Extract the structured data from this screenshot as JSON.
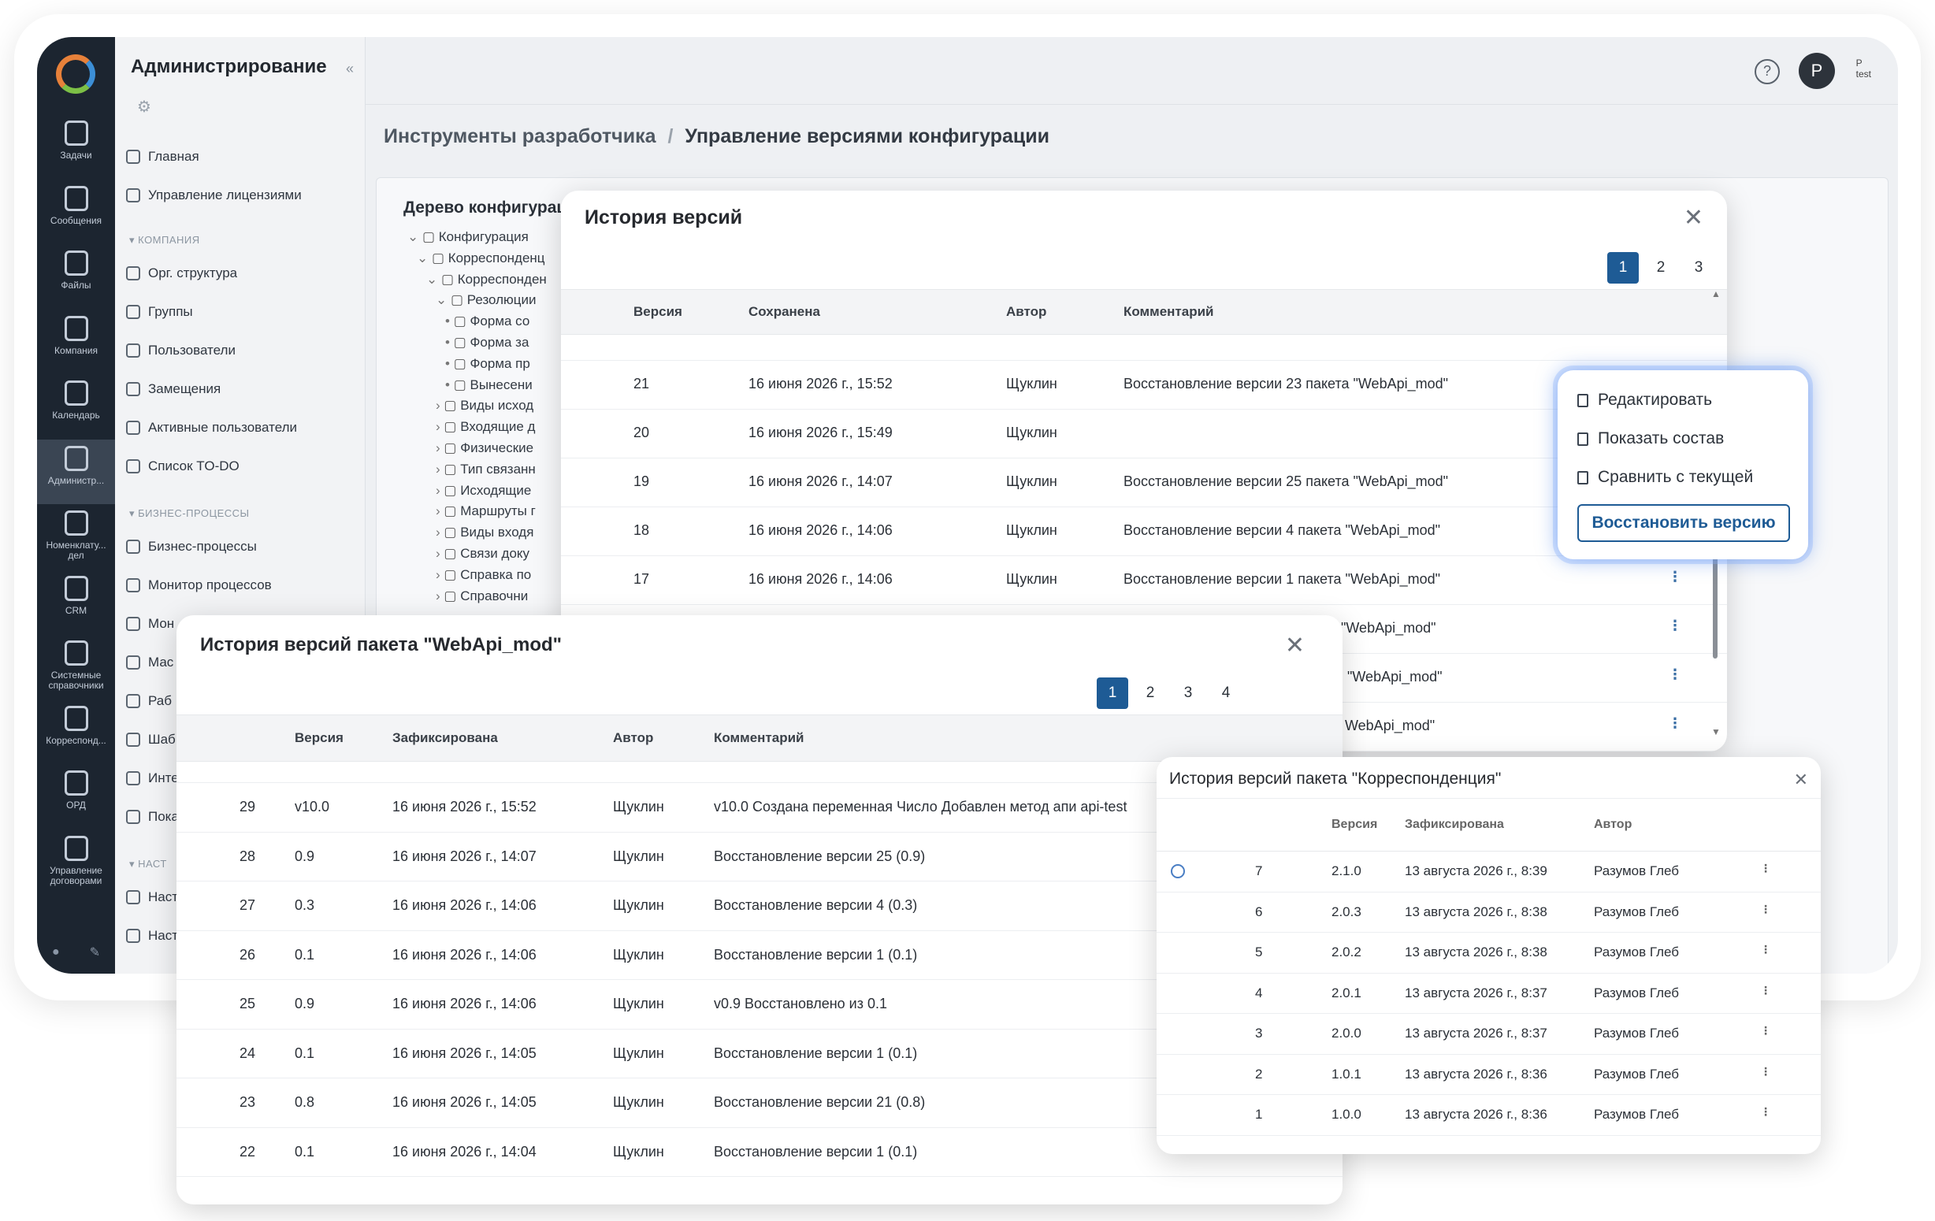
{
  "rail": {
    "items": [
      {
        "label": "Задачи",
        "icon": "tasks-icon"
      },
      {
        "label": "Сообщения",
        "icon": "messages-icon"
      },
      {
        "label": "Файлы",
        "icon": "files-icon"
      },
      {
        "label": "Компания",
        "icon": "company-icon"
      },
      {
        "label": "Календарь",
        "icon": "calendar-icon"
      },
      {
        "label": "Администр...",
        "icon": "gear-icon"
      },
      {
        "label": "Номенклату...\nдел",
        "icon": "nomenclature-icon"
      },
      {
        "label": "CRM",
        "icon": "crm-icon"
      },
      {
        "label": "Системные\nсправочники",
        "icon": "directory-icon"
      },
      {
        "label": "Корреспонд...",
        "icon": "correspondence-icon"
      },
      {
        "label": "ОРД",
        "icon": "ord-icon"
      },
      {
        "label": "Управление\nдоговорами",
        "icon": "contracts-icon"
      }
    ]
  },
  "admin": {
    "title": "Администрирование",
    "collapse": "«",
    "items": {
      "home": "Главная",
      "licenses": "Управление лицензиями",
      "group_company": "КОМПАНИЯ",
      "org": "Орг. структура",
      "groups": "Группы",
      "users": "Пользователи",
      "substitutions": "Замещения",
      "active_users": "Активные пользователи",
      "todo": "Список TO-DO",
      "group_bp": "БИЗНЕС-ПРОЦЕССЫ",
      "bp": "Бизнес-процессы",
      "monitor": "Монитор процессов",
      "mon2": "Мон",
      "mas": "Мас",
      "rab": "Раб",
      "sha": "Шаб",
      "int": "Инте",
      "pok": "Пока",
      "group_settings": "НАСТ",
      "nast1": "Наст",
      "nast2": "Наст"
    }
  },
  "topbar": {
    "help": "?",
    "avatar_letter": "P",
    "user_line1": "P",
    "user_line2": "test"
  },
  "breadcrumb": {
    "part1": "Инструменты разработчика",
    "sep": "/",
    "part2": "Управление версиями конфигурации"
  },
  "tree": {
    "title": "Дерево конфигурац",
    "rows": [
      "Конфигурация",
      "Корреспонденц",
      "Корреспонден",
      "Резолюции",
      "Форма со",
      "Форма за",
      "Форма пр",
      "Вынесени",
      "Виды исход",
      "Входящие д",
      "Физические",
      "Тип связанн",
      "Исходящие",
      "Маршруты г",
      "Виды входя",
      "Связи доку",
      "Справка по",
      "Справочни"
    ]
  },
  "versions_modal": {
    "title": "История версий",
    "pages": [
      "1",
      "2",
      "3"
    ],
    "columns": {
      "version": "Версия",
      "saved": "Сохранена",
      "author": "Автор",
      "comment": "Комментарий"
    },
    "rows": [
      {
        "v": "21",
        "date": "16 июня 2026 г., 15:52",
        "author": "Щуклин",
        "comment": "Восстановление версии 23 пакета \"WebApi_mod\""
      },
      {
        "v": "20",
        "date": "16 июня 2026 г., 15:49",
        "author": "Щуклин",
        "comment": ""
      },
      {
        "v": "19",
        "date": "16 июня 2026 г., 14:07",
        "author": "Щуклин",
        "comment": "Восстановление версии 25 пакета \"WebApi_mod\""
      },
      {
        "v": "18",
        "date": "16 июня 2026 г., 14:06",
        "author": "Щуклин",
        "comment": "Восстановление версии 4 пакета \"WebApi_mod\""
      },
      {
        "v": "17",
        "date": "16 июня 2026 г., 14:06",
        "author": "Щуклин",
        "comment": "Восстановление версии 1 пакета \"WebApi_mod\""
      }
    ],
    "tail_rows": [
      "\"WebApi_mod\"",
      "\"WebApi_mod\"",
      "WebApi_mod\""
    ]
  },
  "context_menu": {
    "edit": "Редактировать",
    "show": "Показать состав",
    "compare": "Сравнить с текущей",
    "restore": "Восстановить версию"
  },
  "package_modal": {
    "title": "История версий пакета \"WebApi_mod\"",
    "pages": [
      "1",
      "2",
      "3",
      "4"
    ],
    "columns": {
      "version": "Версия",
      "fixed": "Зафиксирована",
      "author": "Автор",
      "comment": "Комментарий"
    },
    "rows": [
      {
        "n": "29",
        "v": "v10.0",
        "date": "16 июня 2026 г., 15:52",
        "author": "Щуклин",
        "comment": "v10.0 Создана переменная Число Добавлен метод апи api-test"
      },
      {
        "n": "28",
        "v": "0.9",
        "date": "16 июня 2026 г., 14:07",
        "author": "Щуклин",
        "comment": "Восстановление версии 25 (0.9)"
      },
      {
        "n": "27",
        "v": "0.3",
        "date": "16 июня 2026 г., 14:06",
        "author": "Щуклин",
        "comment": "Восстановление версии 4 (0.3)"
      },
      {
        "n": "26",
        "v": "0.1",
        "date": "16 июня 2026 г., 14:06",
        "author": "Щуклин",
        "comment": "Восстановление версии 1 (0.1)"
      },
      {
        "n": "25",
        "v": "0.9",
        "date": "16 июня 2026 г., 14:06",
        "author": "Щуклин",
        "comment": "v0.9 Восстановлено из 0.1"
      },
      {
        "n": "24",
        "v": "0.1",
        "date": "16 июня 2026 г., 14:05",
        "author": "Щуклин",
        "comment": "Восстановление версии 1 (0.1)"
      },
      {
        "n": "23",
        "v": "0.8",
        "date": "16 июня 2026 г., 14:05",
        "author": "Щуклин",
        "comment": "Восстановление версии 21 (0.8)"
      },
      {
        "n": "22",
        "v": "0.1",
        "date": "16 июня 2026 г., 14:04",
        "author": "Щуклин",
        "comment": "Восстановление версии 1 (0.1)"
      }
    ]
  },
  "corr_modal": {
    "title": "История версий пакета \"Корреспонденция\"",
    "columns": {
      "version": "Версия",
      "fixed": "Зафиксирована",
      "author": "Автор"
    },
    "rows": [
      {
        "n": "7",
        "v": "2.1.0",
        "date": "13 августа 2026 г., 8:39",
        "author": "Разумов Глеб",
        "current": true
      },
      {
        "n": "6",
        "v": "2.0.3",
        "date": "13 августа 2026 г., 8:38",
        "author": "Разумов Глеб",
        "current": false
      },
      {
        "n": "5",
        "v": "2.0.2",
        "date": "13 августа 2026 г., 8:38",
        "author": "Разумов Глеб",
        "current": false
      },
      {
        "n": "4",
        "v": "2.0.1",
        "date": "13 августа 2026 г., 8:37",
        "author": "Разумов Глеб",
        "current": false
      },
      {
        "n": "3",
        "v": "2.0.0",
        "date": "13 августа 2026 г., 8:37",
        "author": "Разумов Глеб",
        "current": false
      },
      {
        "n": "2",
        "v": "1.0.1",
        "date": "13 августа 2026 г., 8:36",
        "author": "Разумов Глеб",
        "current": false
      },
      {
        "n": "1",
        "v": "1.0.0",
        "date": "13 августа 2026 г., 8:36",
        "author": "Разумов Глеб",
        "current": false
      }
    ]
  },
  "colors": {
    "accent": "#1e5b95",
    "rail": "#1c2530",
    "logo_orange": "#e7813a",
    "logo_blue": "#3c8fd6",
    "logo_green": "#7cc046"
  }
}
